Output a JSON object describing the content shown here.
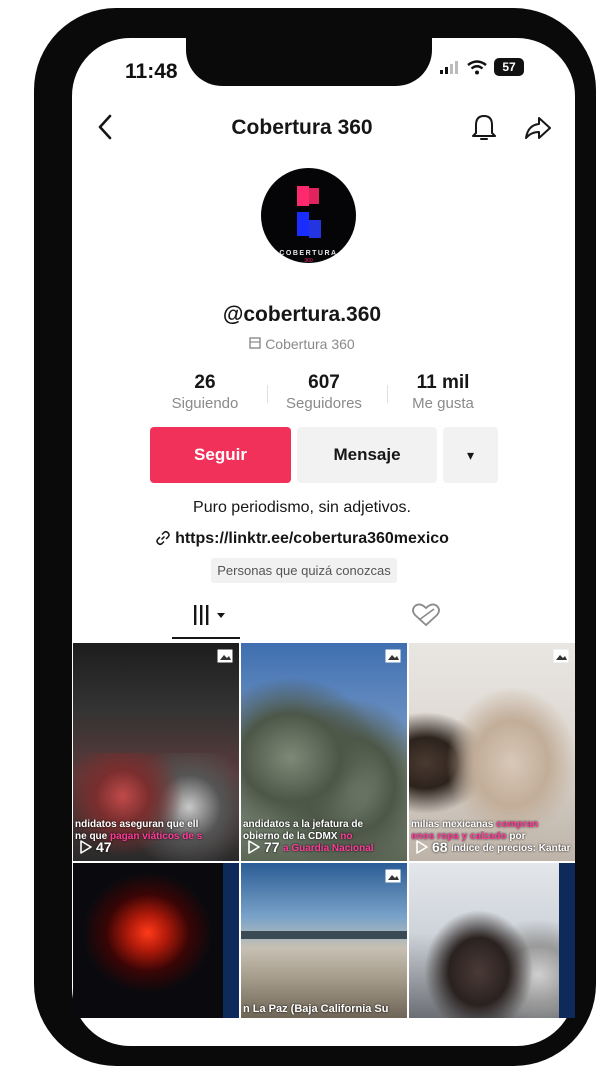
{
  "status_bar": {
    "time": "11:48",
    "battery": "57"
  },
  "header": {
    "title": "Cobertura 360"
  },
  "profile": {
    "avatar_wordmark": "COBERTURA",
    "avatar_number": "360",
    "handle": "@cobertura.360",
    "display_name": "Cobertura 360",
    "stats": [
      {
        "value": "26",
        "label": "Siguiendo"
      },
      {
        "value": "607",
        "label": "Seguidores"
      },
      {
        "value": "11 mil",
        "label": "Me gusta"
      }
    ],
    "bio": "Puro periodismo, sin adjetivos.",
    "link": "https://linktr.ee/cobertura360mexico",
    "suggestions_label": "Personas que quizá conozcas"
  },
  "actions": {
    "follow_label": "Seguir",
    "message_label": "Mensaje",
    "more_label": "▾"
  },
  "tabs": {
    "videos_icon": "grid-icon",
    "liked_icon": "heart-hidden-icon"
  },
  "videos": [
    {
      "line1": "ndidatos aseguran que ell",
      "line2a": "ne que ",
      "line2b": "pagan viáticos de s",
      "views": "47"
    },
    {
      "line1": "andidatos a la jefatura de",
      "line2a": "obierno de la CDMX ",
      "line2b": "no",
      "line3a": "",
      "line3b": "",
      "line3c": "a Guardia Nacional",
      "views": "77"
    },
    {
      "line1": "milias mexicanas ",
      "line1b": "compran",
      "line2a": "",
      "line2b": "enos ropa y calzado",
      "line2c": " por",
      "line3": "índice de precios: Kantar",
      "views": "68"
    },
    {
      "caption": ""
    },
    {
      "caption": "n La Paz (Baja California Su"
    },
    {
      "caption": ""
    }
  ],
  "colors": {
    "accent": "#f2315a",
    "caption_highlight": "#ff3c9a"
  }
}
